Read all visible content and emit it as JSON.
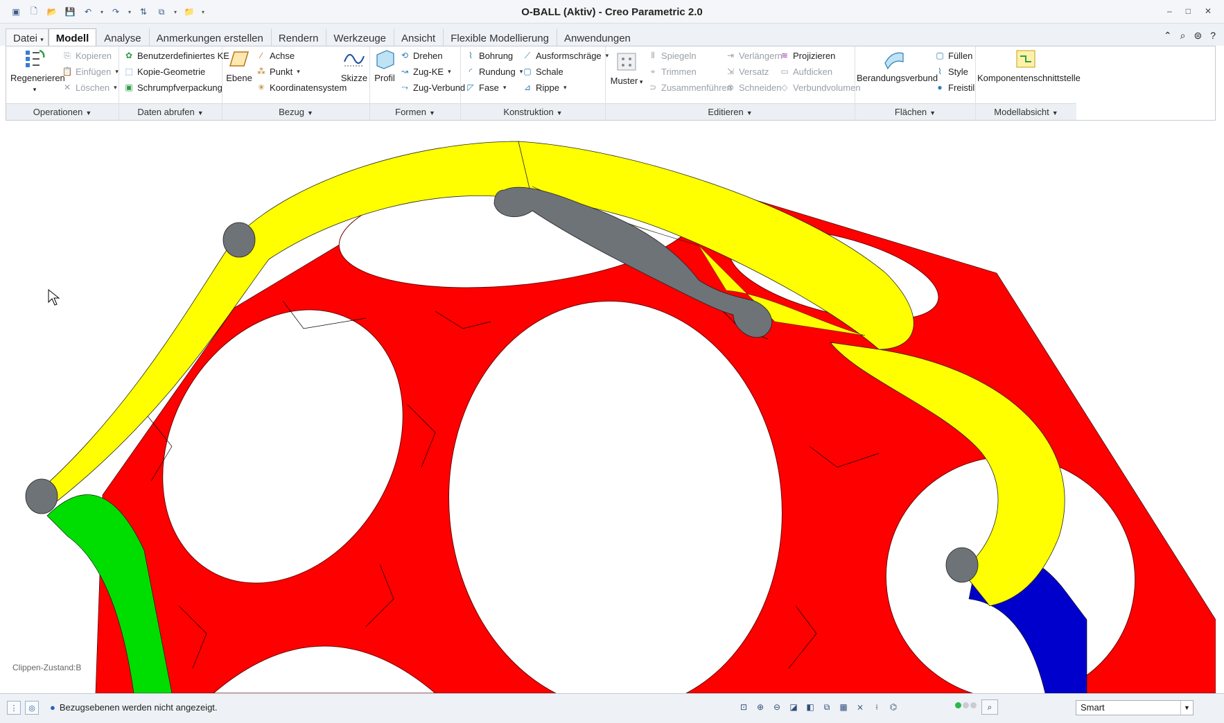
{
  "window": {
    "title": "O-BALL (Aktiv) - Creo Parametric 2.0",
    "controls": [
      "–",
      "□",
      "✕"
    ]
  },
  "quick_access": [
    "app-icon",
    "new-icon",
    "open-icon",
    "save-icon",
    "undo-icon",
    "redo-icon",
    "regenerate-icon",
    "windows-icon",
    "close-window-icon",
    "customize-icon"
  ],
  "tabs": [
    {
      "label": "Datei",
      "kind": "file"
    },
    {
      "label": "Modell",
      "active": true
    },
    {
      "label": "Analyse"
    },
    {
      "label": "Anmerkungen erstellen"
    },
    {
      "label": "Rendern"
    },
    {
      "label": "Werkzeuge"
    },
    {
      "label": "Ansicht"
    },
    {
      "label": "Flexible Modellierung"
    },
    {
      "label": "Anwendungen"
    }
  ],
  "ribbon": {
    "operationen": {
      "label": "Operationen",
      "regenerate": "Regenerieren",
      "copy": "Kopieren",
      "paste": "Einfügen",
      "delete": "Löschen"
    },
    "daten": {
      "label": "Daten abrufen",
      "udf": "Benutzerdefiniertes KE",
      "copy_geom": "Kopie-Geometrie",
      "shrinkwrap": "Schrumpfverpackung"
    },
    "bezug": {
      "label": "Bezug",
      "plane": "Ebene",
      "axis": "Achse",
      "point": "Punkt",
      "csys": "Koordinatensystem",
      "sketch": "Skizze"
    },
    "formen": {
      "label": "Formen",
      "profile": "Profil",
      "revolve": "Drehen",
      "sweep": "Zug-KE",
      "swept_blend": "Zug-Verbund"
    },
    "konstruktion": {
      "label": "Konstruktion",
      "hole": "Bohrung",
      "round": "Rundung",
      "chamfer": "Fase",
      "draft": "Ausformschräge",
      "shell": "Schale",
      "rib": "Rippe"
    },
    "editieren": {
      "label": "Editieren",
      "pattern": "Muster",
      "mirror": "Spiegeln",
      "trim": "Trimmen",
      "merge": "Zusammenführen",
      "extend": "Verlängern",
      "offset": "Versatz",
      "intersect": "Schneiden",
      "project": "Projizieren",
      "thicken": "Aufdicken",
      "solidify": "Verbundvolumen"
    },
    "flaechen": {
      "label": "Flächen",
      "boundary": "Berandungsverbund",
      "fill": "Füllen",
      "style": "Style",
      "freestyle": "Freistil"
    },
    "modellabsicht": {
      "label": "Modellabsicht",
      "component_interface": "Komponentenschnittstelle"
    }
  },
  "viewport": {
    "clip_state": "Clippen-Zustand:B",
    "colors": {
      "red": "#ff0000",
      "yellow": "#ffff00",
      "green": "#00dd00",
      "blue": "#0000cc",
      "gray": "#6e7378"
    }
  },
  "status": {
    "message": "Bezugsebenen werden nicht angezeigt.",
    "filter_value": "Smart"
  }
}
